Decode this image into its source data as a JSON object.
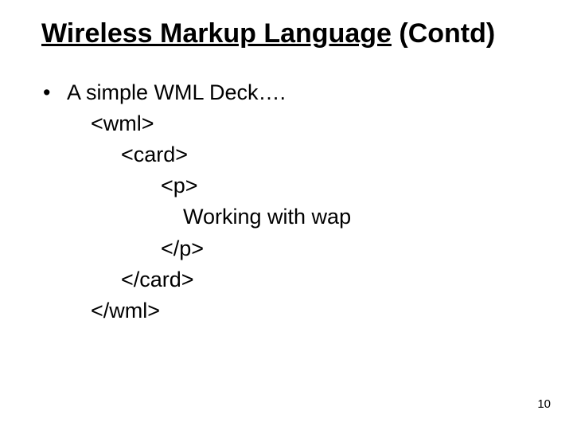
{
  "title": {
    "underlined": "Wireless Markup Language",
    "rest": " (Contd)"
  },
  "bullet": {
    "marker": "•",
    "text": "A simple WML Deck…."
  },
  "code": {
    "l1": "<wml>",
    "l2": "<card>",
    "l3": "<p>",
    "l4": "Working with wap",
    "l5": "</p>",
    "l6": "</card>",
    "l7": "</wml>"
  },
  "page_number": "10"
}
